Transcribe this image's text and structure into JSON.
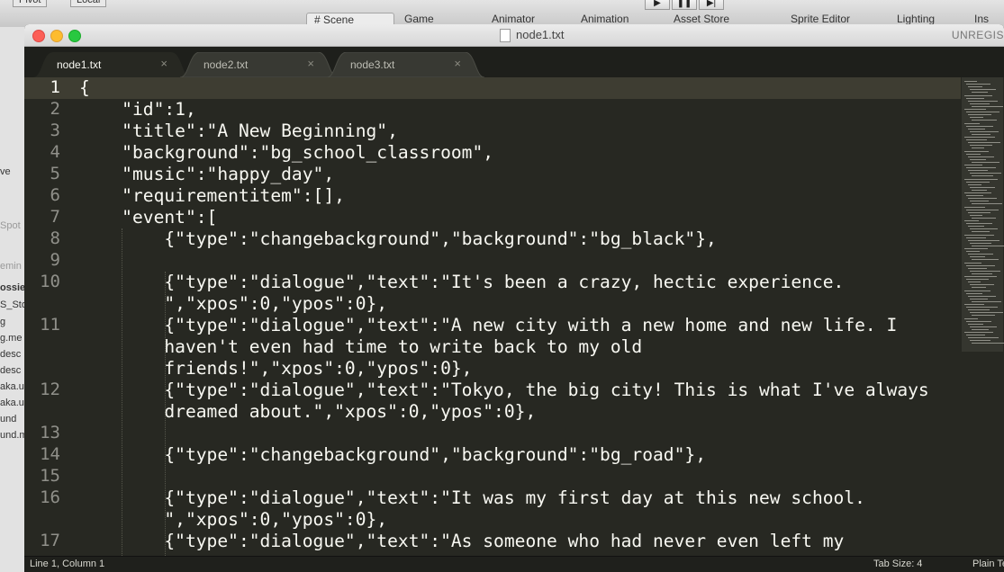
{
  "background_app": {
    "pivot": "Pivot",
    "local": "Local",
    "tabs": [
      "# Scene",
      "Game",
      "Animator",
      "Animation",
      "Asset Store",
      "Sprite Editor",
      "Lighting",
      "Ins"
    ],
    "left_fragments": [
      "ve",
      "Spot",
      "emin",
      "ossie",
      "S_Sto",
      "g",
      "g.me",
      "desc",
      "desc",
      "aka.u",
      "aka.u",
      "und",
      "und.m"
    ]
  },
  "window": {
    "title": "node1.txt",
    "unregistered": "UNREGIS"
  },
  "tabs": [
    {
      "label": "node1.txt",
      "close": "×",
      "active": true
    },
    {
      "label": "node2.txt",
      "close": "×",
      "active": false
    },
    {
      "label": "node3.txt",
      "close": "×",
      "active": false
    }
  ],
  "editor": {
    "lines": [
      {
        "num": "1",
        "text": "{"
      },
      {
        "num": "2",
        "text": "    \"id\":1,"
      },
      {
        "num": "3",
        "text": "    \"title\":\"A New Beginning\","
      },
      {
        "num": "4",
        "text": "    \"background\":\"bg_school_classroom\","
      },
      {
        "num": "5",
        "text": "    \"music\":\"happy_day\","
      },
      {
        "num": "6",
        "text": "    \"requirementitem\":[],"
      },
      {
        "num": "7",
        "text": "    \"event\":["
      },
      {
        "num": "8",
        "text": "        {\"type\":\"changebackground\",\"background\":\"bg_black\"},"
      },
      {
        "num": "9",
        "text": ""
      },
      {
        "num": "10",
        "text": "        {\"type\":\"dialogue\",\"text\":\"It's been a crazy, hectic experience."
      },
      {
        "num": "",
        "text": "        \",\"xpos\":0,\"ypos\":0},"
      },
      {
        "num": "11",
        "text": "        {\"type\":\"dialogue\",\"text\":\"A new city with a new home and new life. I"
      },
      {
        "num": "",
        "text": "        haven't even had time to write back to my old"
      },
      {
        "num": "",
        "text": "        friends!\",\"xpos\":0,\"ypos\":0},"
      },
      {
        "num": "12",
        "text": "        {\"type\":\"dialogue\",\"text\":\"Tokyo, the big city! This is what I've always"
      },
      {
        "num": "",
        "text": "        dreamed about.\",\"xpos\":0,\"ypos\":0},"
      },
      {
        "num": "13",
        "text": ""
      },
      {
        "num": "14",
        "text": "        {\"type\":\"changebackground\",\"background\":\"bg_road\"},"
      },
      {
        "num": "15",
        "text": ""
      },
      {
        "num": "16",
        "text": "        {\"type\":\"dialogue\",\"text\":\"It was my first day at this new school."
      },
      {
        "num": "",
        "text": "        \",\"xpos\":0,\"ypos\":0},"
      },
      {
        "num": "17",
        "text": "        {\"type\":\"dialogue\",\"text\":\"As someone who had never even left my"
      }
    ]
  },
  "status": {
    "position": "Line 1, Column 1",
    "tab_size": "Tab Size: 4",
    "syntax": "Plain Text"
  }
}
